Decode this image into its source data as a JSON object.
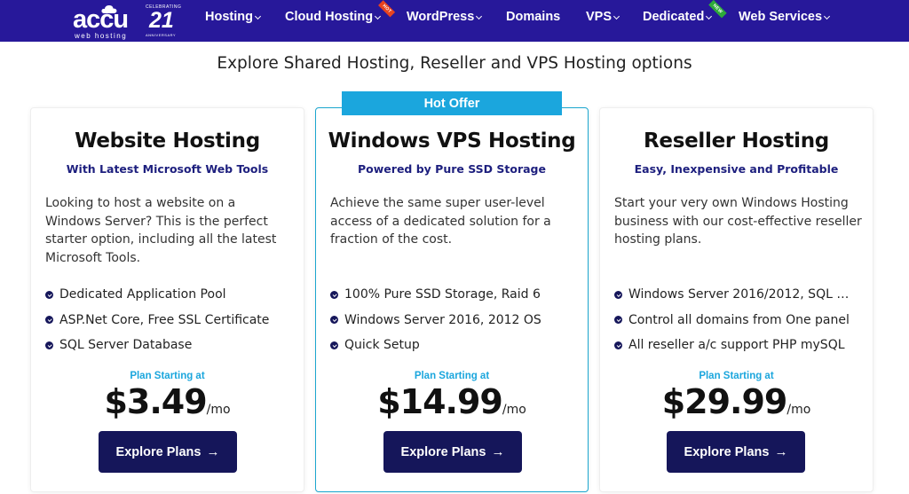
{
  "brand": {
    "name": "accu",
    "tagline": "web hosting",
    "anniversary_number": "21",
    "anniversary_top": "CELEBRATING",
    "anniversary_bottom": "ANNIVERSARY"
  },
  "nav": {
    "items": [
      {
        "label": "Hosting",
        "dropdown": true
      },
      {
        "label": "Cloud Hosting",
        "dropdown": true,
        "ribbon": "HOT"
      },
      {
        "label": "WordPress",
        "dropdown": true
      },
      {
        "label": "Domains",
        "dropdown": false
      },
      {
        "label": "VPS",
        "dropdown": true
      },
      {
        "label": "Dedicated",
        "dropdown": true,
        "ribbon": "NEW"
      },
      {
        "label": "Web Services",
        "dropdown": true
      }
    ]
  },
  "section": {
    "subtitle": "Explore Shared Hosting, Reseller and VPS Hosting options"
  },
  "plans": [
    {
      "title": "Website Hosting",
      "tagline": "With Latest Microsoft Web Tools",
      "description": "Looking to host a website on a Windows Server? This is the perfect starter option, including all the latest Microsoft Tools.",
      "features": [
        "Dedicated Application Pool",
        "ASP.Net Core, Free SSL Certificate",
        "SQL Server Database"
      ],
      "plan_label": "Plan Starting at",
      "price": "$3.49",
      "period": "/mo",
      "cta": "Explore Plans"
    },
    {
      "badge": "Hot Offer",
      "title": "Windows VPS Hosting",
      "tagline": "Powered by Pure SSD Storage",
      "description": "Achieve the same super user-level access of a dedicated solution for a fraction of the cost.",
      "features": [
        "100% Pure SSD Storage, Raid 6",
        "Windows Server 2016, 2012 OS",
        "Quick Setup"
      ],
      "plan_label": "Plan Starting at",
      "price": "$14.99",
      "period": "/mo",
      "cta": "Explore Plans"
    },
    {
      "title": "Reseller Hosting",
      "tagline": "Easy, Inexpensive and Profitable",
      "description": "Start your very own Windows Hosting business with our cost-effective reseller hosting plans.",
      "features": [
        "Windows Server 2016/2012, SQL 2...",
        "Control all domains from One panel",
        "All reseller a/c support PHP mySQL"
      ],
      "plan_label": "Plan Starting at",
      "price": "$29.99",
      "period": "/mo",
      "cta": "Explore Plans"
    }
  ],
  "colors": {
    "nav_bg": "#27189a",
    "accent": "#1ba6dd",
    "button_bg": "#15165a",
    "tagline": "#1d1f7e",
    "hot_ribbon": "#e8431f",
    "new_ribbon": "#2eaa3a"
  }
}
